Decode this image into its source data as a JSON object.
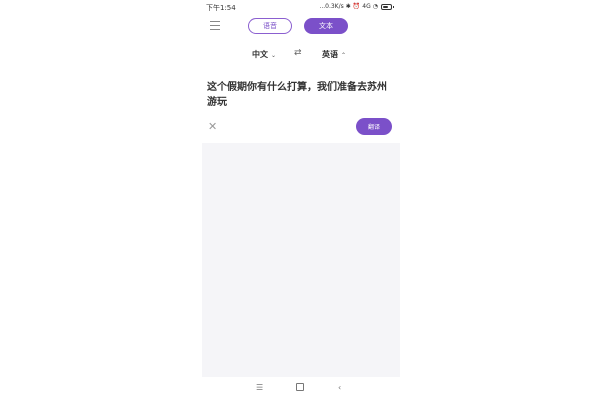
{
  "status_bar": {
    "time": "下午1:54",
    "network_speed": "...0.3K/s",
    "bluetooth": "✱",
    "signal_text": "4G",
    "battery_level": 0.7
  },
  "tabs": [
    {
      "label": "语音"
    },
    {
      "label": "文本"
    }
  ],
  "languages": {
    "source": "中文",
    "target": "英语"
  },
  "input": {
    "text": "这个假期你有什么打算，我们准备去苏州游玩"
  },
  "actions": {
    "translate_label": "翻译"
  },
  "colors": {
    "accent": "#7b50c9",
    "result_bg": "#f5f5f8"
  },
  "icons": {
    "menu": "menu-icon",
    "swap": "swap-icon",
    "clear": "close-icon",
    "nav_menu": "nav-menu-icon",
    "nav_home": "nav-home-icon",
    "nav_back": "nav-back-icon"
  }
}
